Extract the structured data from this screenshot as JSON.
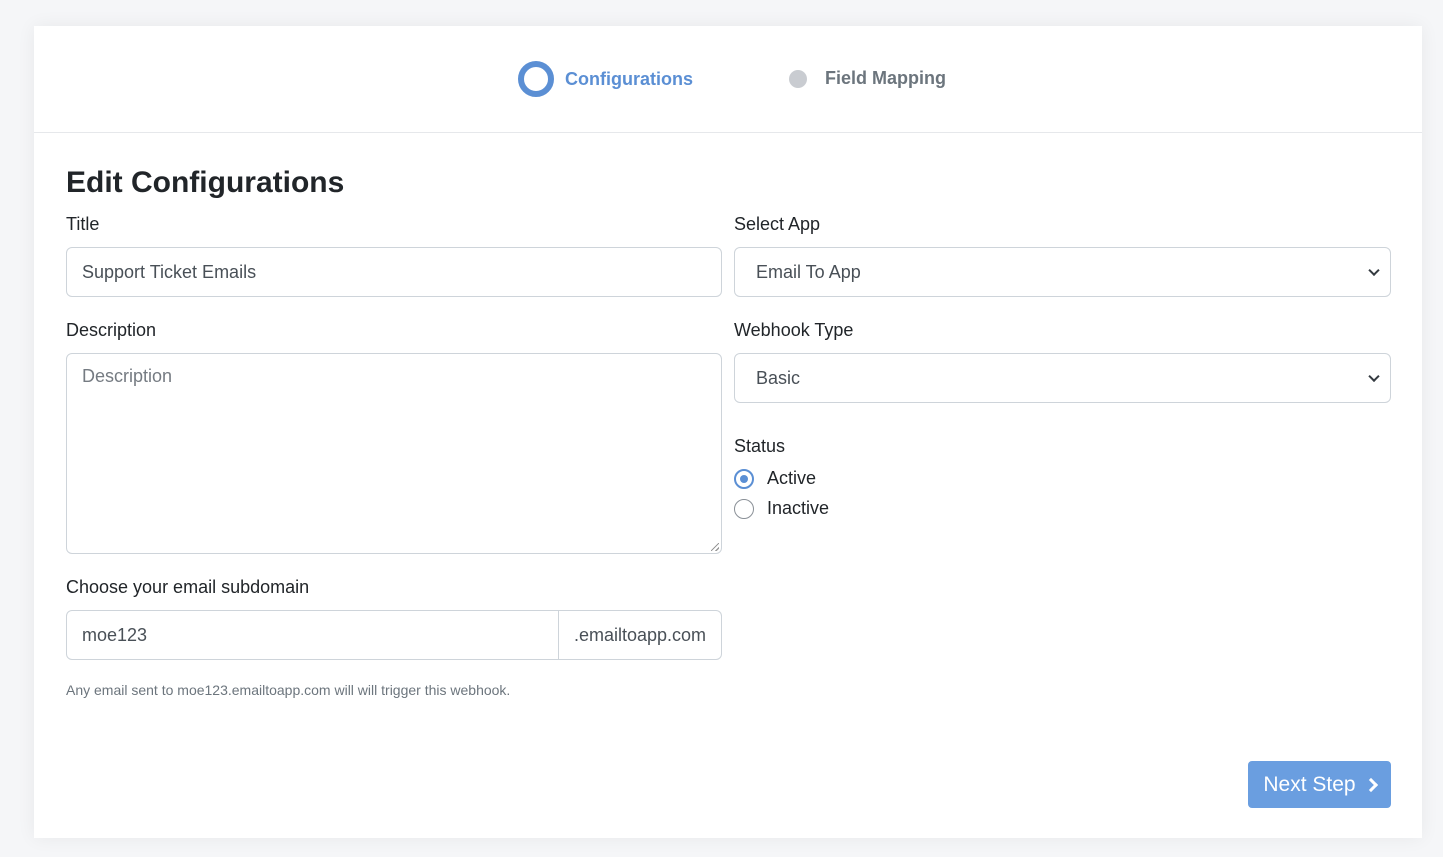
{
  "stepper": {
    "steps": [
      {
        "label": "Configurations",
        "state": "active"
      },
      {
        "label": "Field Mapping",
        "state": "inactive"
      }
    ]
  },
  "form": {
    "heading": "Edit Configurations",
    "title": {
      "label": "Title",
      "value": "Support Ticket Emails"
    },
    "description": {
      "label": "Description",
      "placeholder": "Description",
      "value": ""
    },
    "subdomain": {
      "label": "Choose your email subdomain",
      "value": "moe123",
      "suffix": ".emailtoapp.com",
      "help": "Any email sent to moe123.emailtoapp.com will will trigger this webhook."
    },
    "select_app": {
      "label": "Select App",
      "selected": "Email To App"
    },
    "webhook_type": {
      "label": "Webhook Type",
      "selected": "Basic"
    },
    "status": {
      "label": "Status",
      "options": [
        {
          "label": "Active",
          "checked": true
        },
        {
          "label": "Inactive",
          "checked": false
        }
      ]
    }
  },
  "actions": {
    "next_label": "Next Step"
  },
  "colors": {
    "accent": "#5b8fd4",
    "button": "#6a9ee0",
    "inactive_step": "#c9ccd1"
  }
}
